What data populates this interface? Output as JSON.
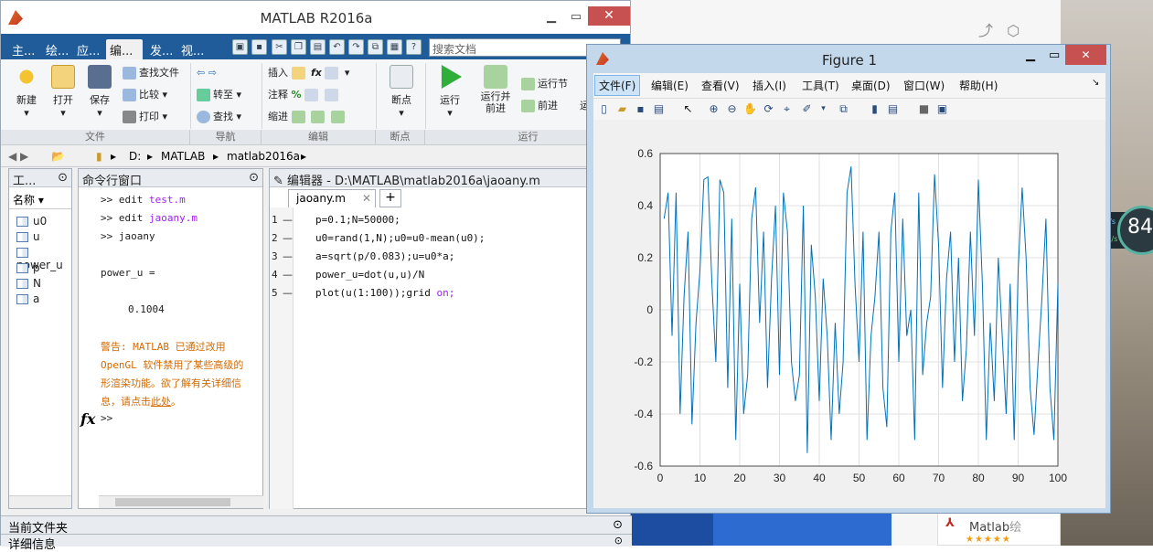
{
  "matlab": {
    "title": "MATLAB R2016a",
    "tabs": [
      "主...",
      "绘...",
      "应...",
      "编...",
      "发...",
      "视..."
    ],
    "search_placeholder": "搜索文档",
    "ribbon": {
      "new": "新建",
      "open": "打开",
      "save": "保存",
      "find_files": "查找文件",
      "compare": "比较",
      "print": "打印",
      "goto": "转至",
      "find": "查找",
      "insert": "插入",
      "comment": "注释",
      "indent": "缩进",
      "breakpoints": "断点",
      "run": "运行",
      "run_advance": "运行并\n前进",
      "run_section": "运行节",
      "advance": "前进",
      "run_more": "运",
      "groups": {
        "file": "文件",
        "navigate": "导航",
        "edit": "编辑",
        "breakpoints": "断点",
        "run": "运行"
      }
    },
    "address": {
      "drive": "D:",
      "folder1": "MATLAB",
      "folder2": "matlab2016a"
    },
    "workspace": {
      "title": "工...",
      "column": "名称",
      "items": [
        "u0",
        "u",
        "power_u",
        "p",
        "N",
        "a"
      ]
    },
    "command_window": {
      "title": "命令行窗口",
      "lines": [
        ">> edit test.m",
        ">> edit jaoany.m",
        ">> jaoany",
        "",
        "power_u =",
        "",
        "    0.1004",
        ""
      ],
      "cmd1_prefix": ">> edit ",
      "cmd1_file": "test.m",
      "cmd2_prefix": ">> edit ",
      "cmd2_file": "jaoany.m",
      "cmd3": ">> jaoany",
      "var_label": "power_u =",
      "var_value": "0.1004",
      "warning_lines": [
        "警告: MATLAB 已通过改用",
        "OpenGL 软件禁用了某些高级的",
        "形渲染功能。欲了解有关详细信",
        "息，请点击"
      ],
      "warning_link": "此处",
      "warning_end": "。",
      "prompt": ">>",
      "fx": "fx"
    },
    "editor": {
      "title": "编辑器 - D:\\MATLAB\\matlab2016a\\jaoany.m",
      "tab": "jaoany.m",
      "lines": [
        {
          "n": "1",
          "code": "p=0.1;N=50000;"
        },
        {
          "n": "2",
          "code": "u0=rand(1,N);u0=u0-mean(u0);"
        },
        {
          "n": "3",
          "code": "a=sqrt(p/0.083);u=u0*a;"
        },
        {
          "n": "4",
          "code": "power_u=dot(u,u)/N"
        },
        {
          "n": "5",
          "code": "plot(u(1:100));grid ",
          "kw": "on;"
        }
      ]
    },
    "current_folder": "当前文件夹",
    "details": "详细信息"
  },
  "figure": {
    "title": "Figure 1",
    "menu": [
      "文件(F)",
      "编辑(E)",
      "查看(V)",
      "插入(I)",
      "工具(T)",
      "桌面(D)",
      "窗口(W)",
      "帮助(H)"
    ]
  },
  "chart_data": {
    "type": "line",
    "xlabel": "",
    "ylabel": "",
    "title": "",
    "xlim": [
      0,
      100
    ],
    "ylim": [
      -0.6,
      0.6
    ],
    "xticks": [
      "0",
      "10",
      "20",
      "30",
      "40",
      "50",
      "60",
      "70",
      "80",
      "90",
      "100"
    ],
    "yticks": [
      "0.6",
      "0.4",
      "0.2",
      "0",
      "-0.2",
      "-0.4",
      "-0.6"
    ],
    "grid": true,
    "color": "#0072bd",
    "x": [
      1,
      2,
      3,
      4,
      5,
      6,
      7,
      8,
      9,
      10,
      11,
      12,
      13,
      14,
      15,
      16,
      17,
      18,
      19,
      20,
      21,
      22,
      23,
      24,
      25,
      26,
      27,
      28,
      29,
      30,
      31,
      32,
      33,
      34,
      35,
      36,
      37,
      38,
      39,
      40,
      41,
      42,
      43,
      44,
      45,
      46,
      47,
      48,
      49,
      50,
      51,
      52,
      53,
      54,
      55,
      56,
      57,
      58,
      59,
      60,
      61,
      62,
      63,
      64,
      65,
      66,
      67,
      68,
      69,
      70,
      71,
      72,
      73,
      74,
      75,
      76,
      77,
      78,
      79,
      80,
      81,
      82,
      83,
      84,
      85,
      86,
      87,
      88,
      89,
      90,
      91,
      92,
      93,
      94,
      95,
      96,
      97,
      98,
      99,
      100
    ],
    "y": [
      0.35,
      0.45,
      -0.1,
      0.45,
      -0.4,
      0.05,
      0.3,
      -0.44,
      -0.05,
      0.15,
      0.5,
      0.51,
      0.1,
      -0.2,
      0.5,
      0.45,
      -0.3,
      0.35,
      -0.5,
      0.1,
      -0.4,
      -0.25,
      0.35,
      0.47,
      -0.05,
      0.3,
      -0.3,
      0.12,
      0.4,
      -0.25,
      0.45,
      0.3,
      -0.2,
      -0.35,
      -0.25,
      0.4,
      -0.55,
      0.25,
      0.05,
      -0.35,
      0.12,
      -0.1,
      -0.5,
      -0.05,
      -0.4,
      -0.2,
      0.45,
      0.55,
      0.1,
      -0.2,
      0.3,
      -0.5,
      -0.1,
      0.05,
      0.3,
      -0.3,
      -0.45,
      0.3,
      0.45,
      -0.2,
      0.35,
      -0.1,
      0.0,
      -0.5,
      0.45,
      -0.25,
      -0.05,
      0.05,
      0.52,
      0.25,
      -0.3,
      0.12,
      0.3,
      -0.2,
      0.2,
      -0.35,
      -0.15,
      0.3,
      -0.1,
      0.5,
      0.1,
      -0.5,
      -0.05,
      -0.35,
      0.2,
      -0.1,
      -0.4,
      0.1,
      -0.5,
      0.15,
      0.47,
      0.2,
      -0.3,
      -0.48,
      -0.2,
      0.05,
      0.35,
      -0.3,
      -0.5,
      0.1
    ]
  }
}
